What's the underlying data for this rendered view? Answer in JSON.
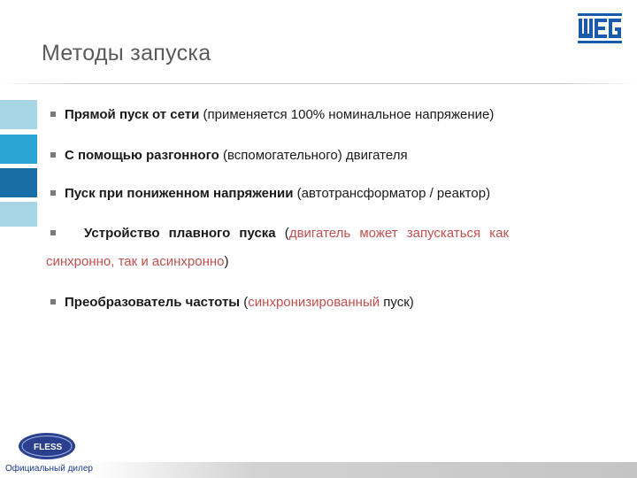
{
  "slide": {
    "title": "Методы запуска",
    "logo": "WEG",
    "items": [
      {
        "bold": "Прямой пуск от сети",
        "rest": " (применяется 100% номинальное напряжение)"
      },
      {
        "bold": "С помощью разгонного",
        "rest": " (вспомогательного) двигателя"
      },
      {
        "bold": "Пуск при пониженном напряжении",
        "rest": " (автотрансформатор / реактор)"
      },
      {
        "bold": "Устройство плавного пуска",
        "open": " (",
        "red_line1": "двигатель может запускаться как",
        "red_line2": "синхронно, так и асинхронно",
        "close": ")"
      },
      {
        "bold": "Преобразователь частоты",
        "open": " (",
        "red": "синхронизированный",
        "rest": " пуск)"
      }
    ],
    "footer": "Официальный дилер",
    "dealer_logo": "FLESS"
  }
}
